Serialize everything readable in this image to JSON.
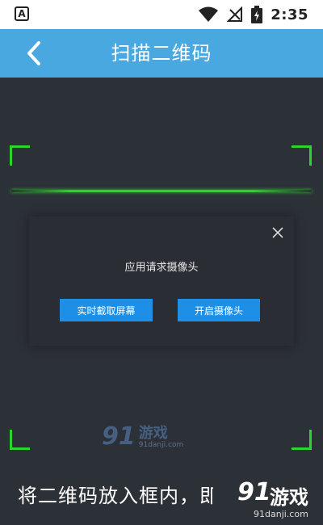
{
  "status_bar": {
    "notification_icon": "A",
    "time": "2:35",
    "icons": [
      "wifi-icon",
      "no-signal-icon",
      "battery-charging-icon"
    ]
  },
  "header": {
    "title": "扫描二维码",
    "back_icon": "chevron-left-icon"
  },
  "dialog": {
    "message": "应用请求摄像头",
    "button_live": "实时截取屏幕",
    "button_camera": "开启摄像头",
    "close_icon": "close-icon"
  },
  "instruction": "将二维码放入框内，即",
  "watermark_center": {
    "logo": "91",
    "name": "游戏",
    "url": "91danji.com"
  },
  "watermark_corner": {
    "logo": "91",
    "name": "游戏",
    "url": "91danji.com"
  },
  "colors": {
    "header_bg": "#4aa8e0",
    "scan_bg": "#2c3037",
    "scan_green": "#2bd52b",
    "button_blue": "#1e8fe6"
  }
}
